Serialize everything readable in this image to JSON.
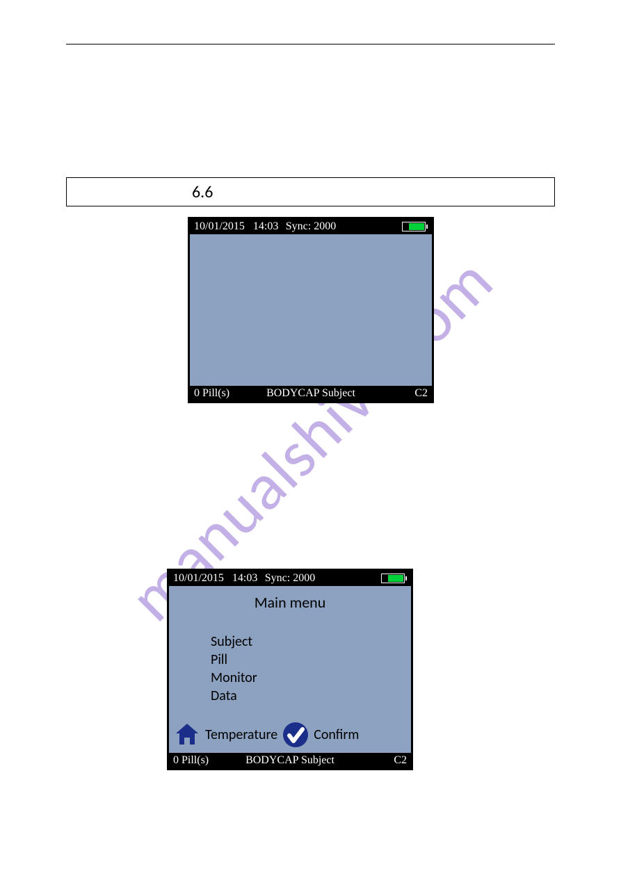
{
  "watermark": "manualshive.com",
  "section_number": "6.6",
  "device1": {
    "top": {
      "date": "10/01/2015",
      "time": "14:03",
      "sync": "Sync: 2000"
    },
    "bottom": {
      "pills": "0 Pill(s)",
      "subject": "BODYCAP Subject",
      "channel": "C2"
    }
  },
  "device2": {
    "top": {
      "date": "10/01/2015",
      "time": "14:03",
      "sync": "Sync: 2000"
    },
    "main_menu_title": "Main menu",
    "menu_items": {
      "0": "Subject",
      "1": "Pill",
      "2": "Monitor",
      "3": "Data"
    },
    "actions": {
      "temperature": "Temperature",
      "confirm": "Confirm"
    },
    "bottom": {
      "pills": "0 Pill(s)",
      "subject": "BODYCAP Subject",
      "channel": "C2"
    }
  }
}
